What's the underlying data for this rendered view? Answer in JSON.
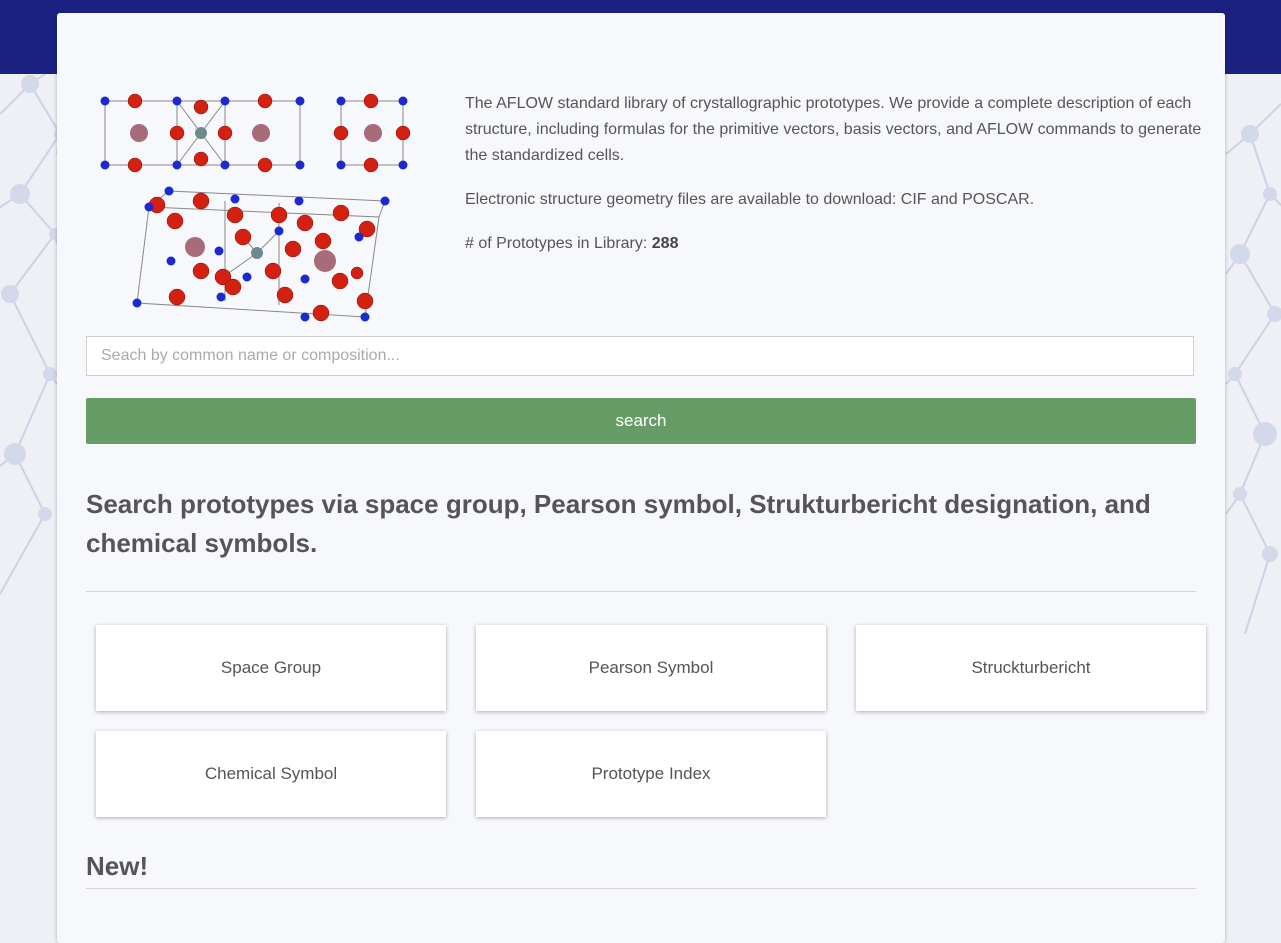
{
  "intro": {
    "description": "The AFLOW standard library of crystallographic prototypes. We provide a complete description of each structure, including formulas for the primitive vectors, basis vectors, and AFLOW commands to generate the standardized cells.",
    "files_note": "Electronic structure geometry files are available to download: CIF and POSCAR.",
    "count_label": "# of Prototypes in Library: ",
    "count_value": "288"
  },
  "search": {
    "placeholder": "Seach by common name or composition...",
    "value": "",
    "button_label": "search"
  },
  "section_heading": "Search prototypes via space group, Pearson symbol, Strukturbericht designation, and chemical symbols.",
  "tiles": [
    {
      "label": "Space Group"
    },
    {
      "label": "Pearson Symbol"
    },
    {
      "label": "Struckturbericht"
    },
    {
      "label": "Chemical Symbol"
    },
    {
      "label": "Prototype Index"
    }
  ],
  "new_heading": "New!",
  "colors": {
    "topbar": "#1b2180",
    "search_button": "#679c67",
    "atom_red": "#d42010",
    "atom_blue": "#1a2ad0",
    "atom_pink": "#a86b7a",
    "atom_gray": "#6a8a8e"
  },
  "icons": {
    "hero": "crystal-structure-image",
    "background": "molecular-network-background"
  }
}
